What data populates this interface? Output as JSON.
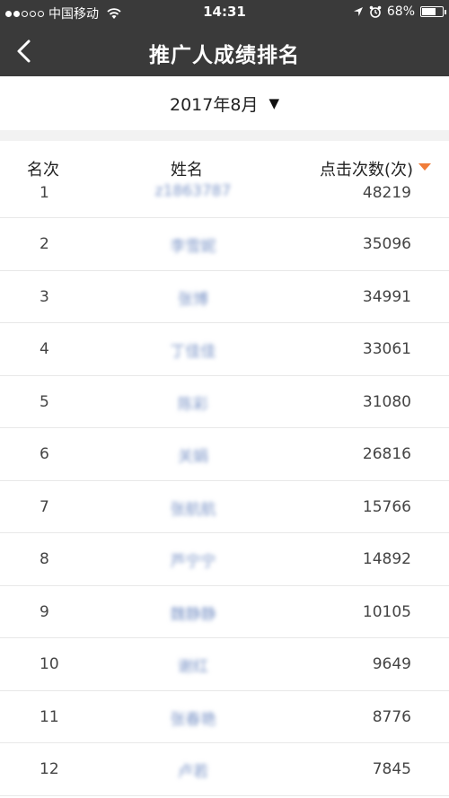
{
  "status_bar": {
    "carrier": "中国移动",
    "time": "14:31",
    "battery": "68%",
    "battery_level": 0.68
  },
  "nav": {
    "title": "推广人成绩排名",
    "back_icon": "chevron-left-icon"
  },
  "filter": {
    "month": "2017年8月",
    "caret": "▼"
  },
  "table": {
    "headers": {
      "rank": "名次",
      "name": "姓名",
      "clicks": "点击次数(次)"
    },
    "sort_color": "#f07d3a",
    "rows": [
      {
        "rank": "1",
        "name": "z1863787",
        "clicks": "48219"
      },
      {
        "rank": "2",
        "name": "李雪妮",
        "clicks": "35096"
      },
      {
        "rank": "3",
        "name": "张博",
        "clicks": "34991"
      },
      {
        "rank": "4",
        "name": "丁佳佳",
        "clicks": "33061"
      },
      {
        "rank": "5",
        "name": "陈彩",
        "clicks": "31080"
      },
      {
        "rank": "6",
        "name": "关娟",
        "clicks": "26816"
      },
      {
        "rank": "7",
        "name": "张航航",
        "clicks": "15766"
      },
      {
        "rank": "8",
        "name": "芦宁宁",
        "clicks": "14892"
      },
      {
        "rank": "9",
        "name": "魏静静",
        "clicks": "10105"
      },
      {
        "rank": "10",
        "name": "谢红",
        "clicks": "9649"
      },
      {
        "rank": "11",
        "name": "张春艳",
        "clicks": "8776"
      },
      {
        "rank": "12",
        "name": "卢若",
        "clicks": "7845"
      }
    ]
  }
}
